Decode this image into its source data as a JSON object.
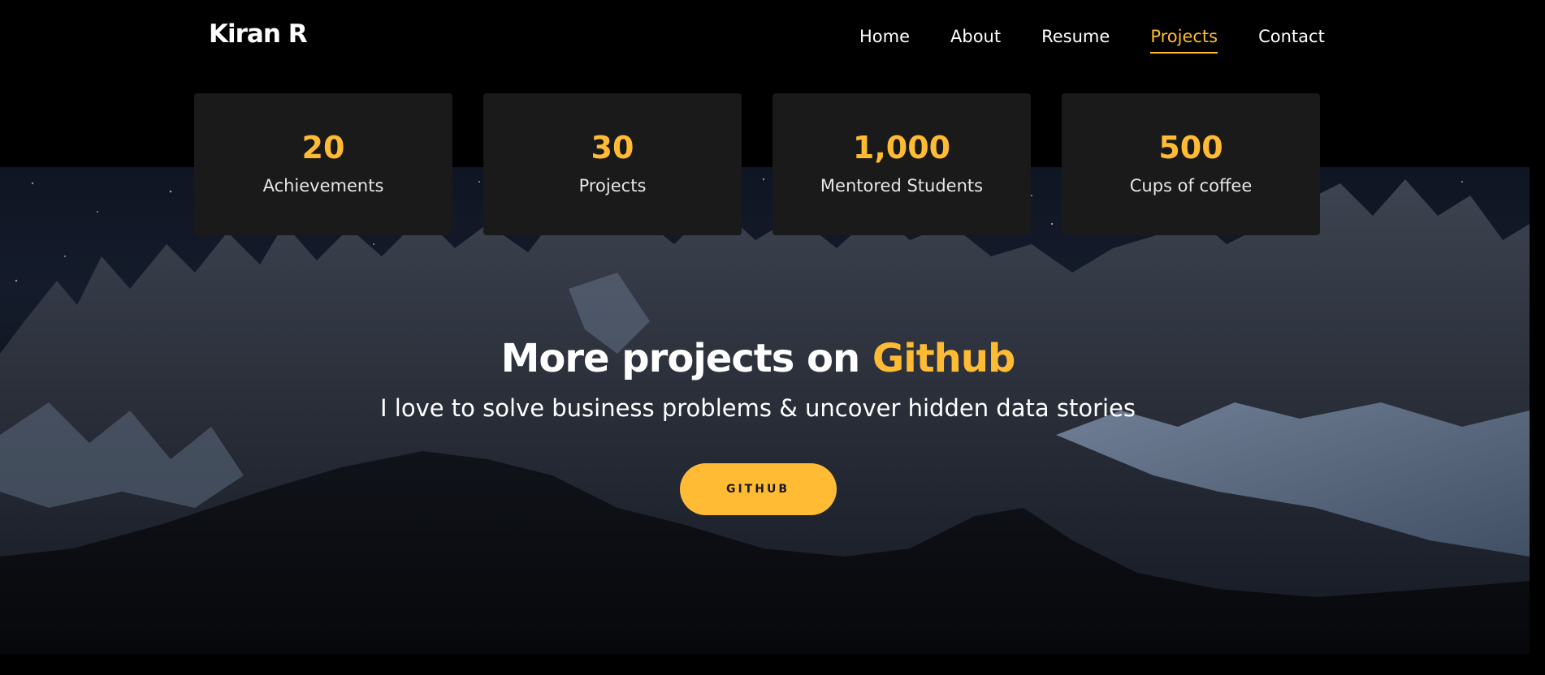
{
  "header": {
    "brand": "Kiran R",
    "nav": [
      {
        "label": "Home",
        "active": false
      },
      {
        "label": "About",
        "active": false
      },
      {
        "label": "Resume",
        "active": false
      },
      {
        "label": "Projects",
        "active": true
      },
      {
        "label": "Contact",
        "active": false
      }
    ]
  },
  "stats": [
    {
      "value": "20",
      "label": "Achievements"
    },
    {
      "value": "30",
      "label": "Projects"
    },
    {
      "value": "1,000",
      "label": "Mentored Students"
    },
    {
      "value": "500",
      "label": "Cups of coffee"
    }
  ],
  "cta": {
    "title_main": "More projects on ",
    "title_accent": "Github",
    "subtitle": "I love to solve business problems & uncover hidden data stories",
    "button_label": "GITHUB"
  },
  "colors": {
    "accent": "#ffbb33",
    "background": "#000000",
    "card": "#1a1a1a",
    "text": "#ffffff"
  }
}
